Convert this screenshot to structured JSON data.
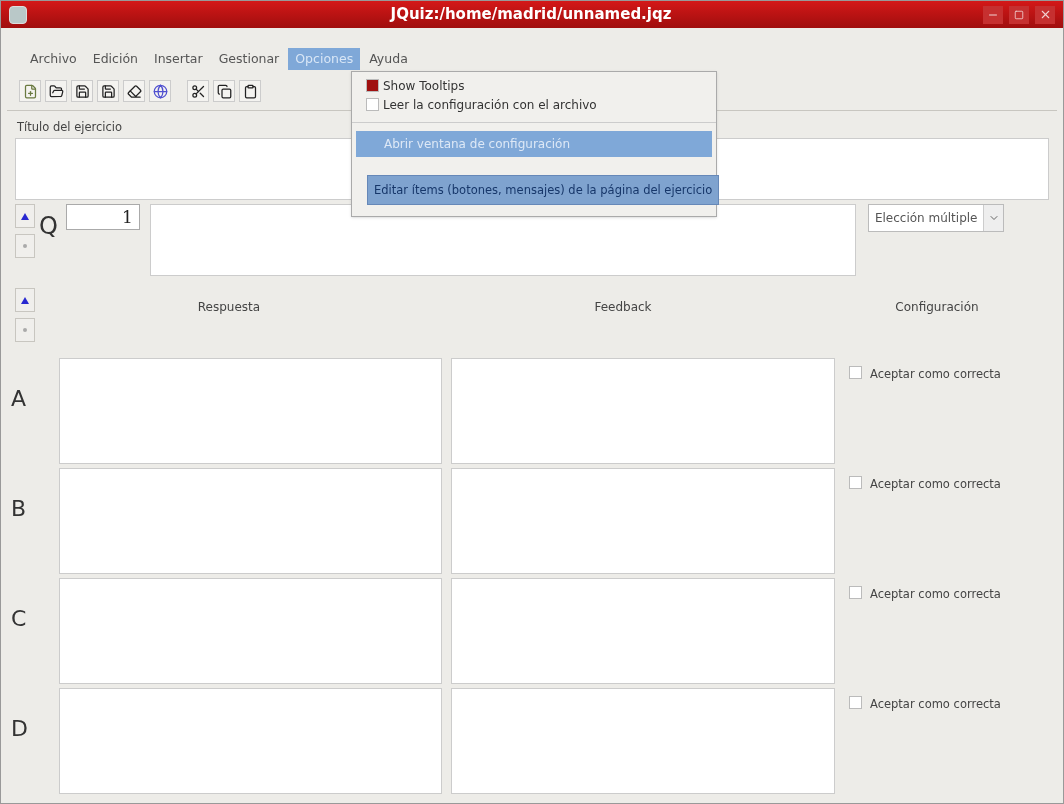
{
  "window": {
    "title": "JQuiz:/home/madrid/unnamed.jqz"
  },
  "menu_bar": [
    {
      "label": "Archivo",
      "selected": false
    },
    {
      "label": "Edición",
      "selected": false
    },
    {
      "label": "Insertar",
      "selected": false
    },
    {
      "label": "Gestionar",
      "selected": false
    },
    {
      "label": "Opciones",
      "selected": true
    },
    {
      "label": "Ayuda",
      "selected": false
    }
  ],
  "toolbar": [
    {
      "kind": "new"
    },
    {
      "kind": "open"
    },
    {
      "kind": "save"
    },
    {
      "kind": "saveas"
    },
    {
      "kind": "erase"
    },
    {
      "kind": "web"
    },
    {
      "kind": "cut"
    },
    {
      "kind": "copy"
    },
    {
      "kind": "paste"
    }
  ],
  "options_menu": {
    "items": [
      {
        "kind": "check",
        "label": "Show Tooltips",
        "checked": true,
        "selected": false
      },
      {
        "kind": "check",
        "label": "Leer la configuración con el archivo",
        "checked": false,
        "selected": false
      },
      {
        "kind": "separator"
      },
      {
        "kind": "item",
        "label": "Abrir ventana de configuración",
        "selected": true
      }
    ]
  },
  "tooltip": "Editar ítems (botones, mensajes) de la página del ejercicio",
  "exercise_title": {
    "label": "Título del ejercicio"
  },
  "question": {
    "prefix": "Q",
    "number": "1",
    "type": "Elección múltiple"
  },
  "columns": [
    "Respuesta",
    "Feedback",
    "Configuración"
  ],
  "answers": [
    {
      "letter": "A",
      "accept": "Aceptar como correcta",
      "checked": false
    },
    {
      "letter": "B",
      "accept": "Aceptar como correcta",
      "checked": false
    },
    {
      "letter": "C",
      "accept": "Aceptar como correcta",
      "checked": false
    },
    {
      "letter": "D",
      "accept": "Aceptar como correcta",
      "checked": false
    }
  ]
}
